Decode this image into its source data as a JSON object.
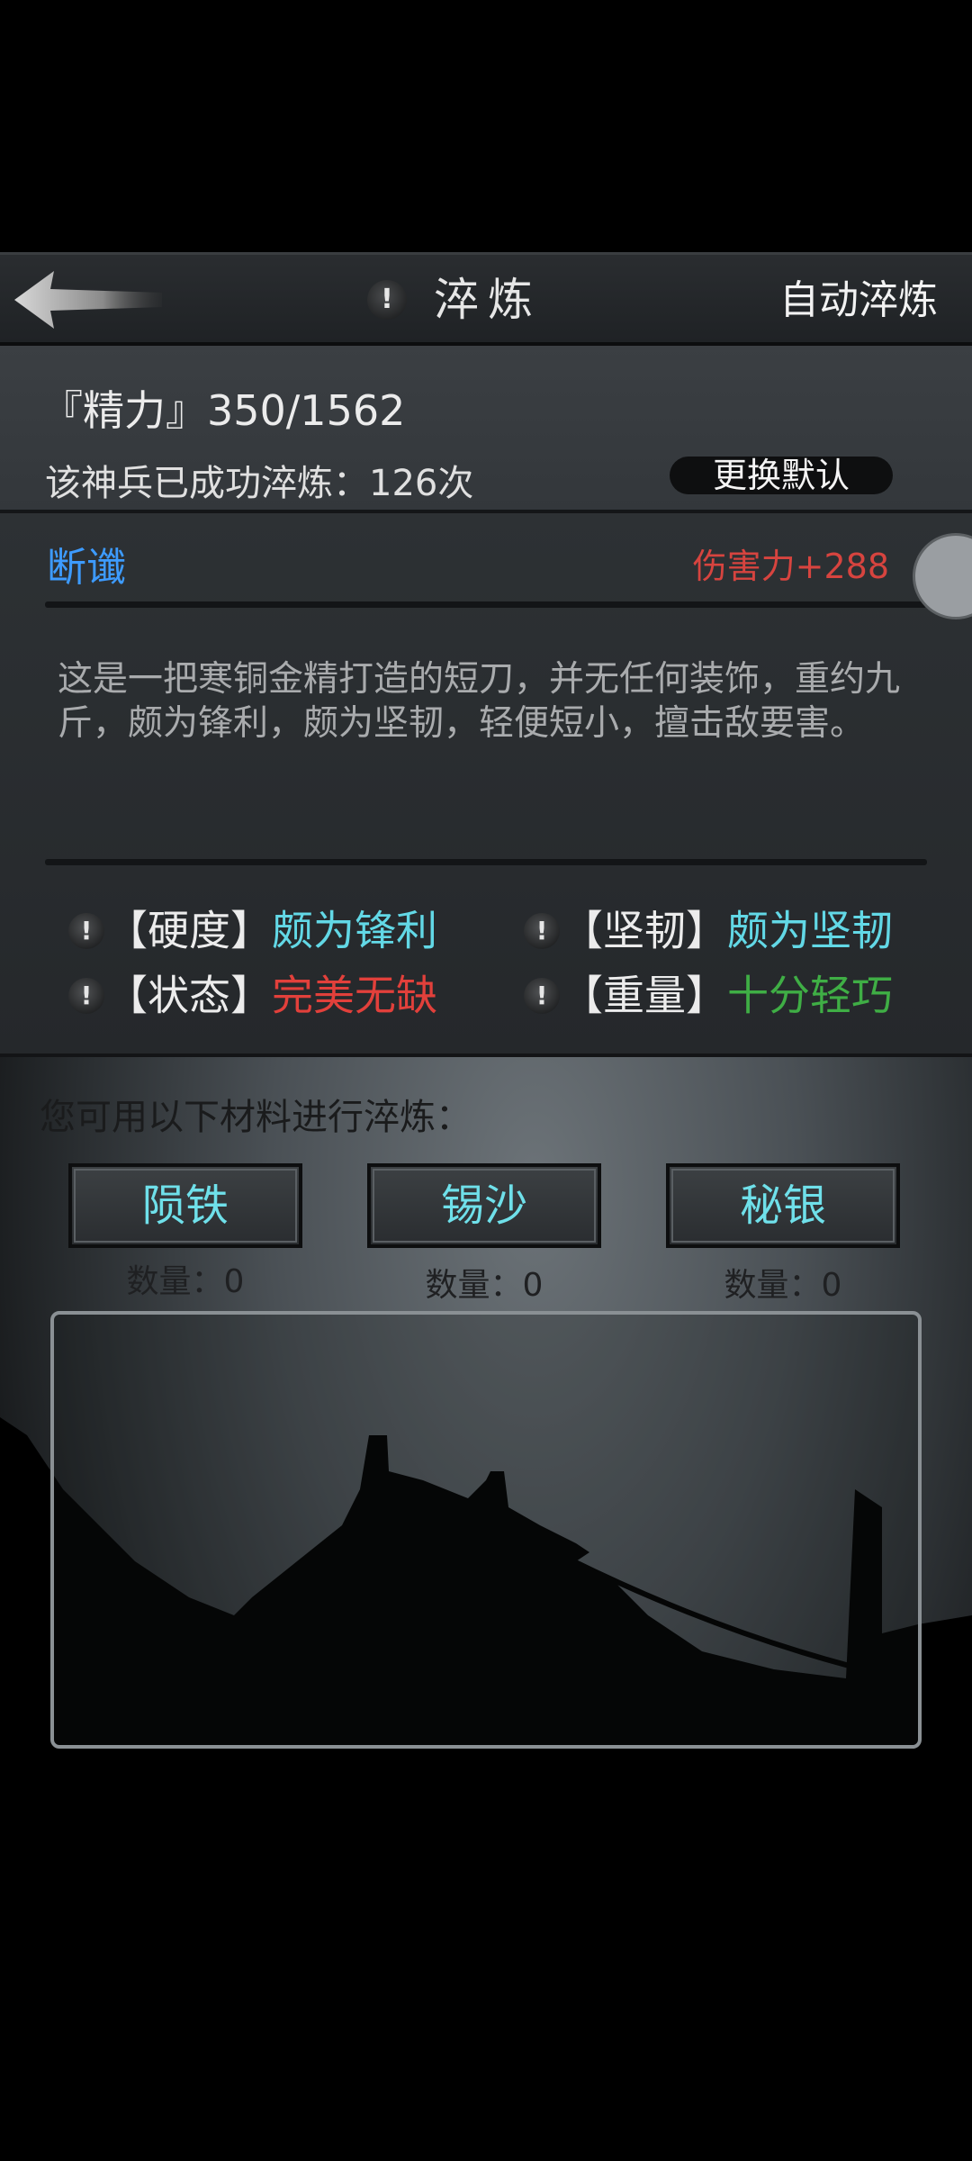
{
  "titlebar": {
    "title": "淬炼",
    "auto_refine": "自动淬炼",
    "info_icon": "!",
    "back_icon": "arrow-left-icon"
  },
  "info": {
    "energy": "『精力』350/1562",
    "refine_count": "该神兵已成功淬炼：126次",
    "swap_default": "更换默认"
  },
  "weapon": {
    "name": "断谶",
    "damage": "伤害力+288",
    "description": "这是一把寒铜金精打造的短刀，并无任何装饰，重约九斤，颇为锋利，颇为坚韧，轻便短小，擅击敌要害。",
    "attributes": [
      {
        "label": "【硬度】",
        "value": "颇为锋利",
        "color": "#62d8e6"
      },
      {
        "label": "【坚韧】",
        "value": "颇为坚韧",
        "color": "#62d8e6"
      },
      {
        "label": "【状态】",
        "value": "完美无缺",
        "color": "#e2403b"
      },
      {
        "label": "【重量】",
        "value": "十分轻巧",
        "color": "#3fae45"
      }
    ],
    "attr_icon": "!"
  },
  "materials": {
    "title": "您可用以下材料进行淬炼：",
    "items": [
      {
        "name": "陨铁",
        "count": "数量：0"
      },
      {
        "name": "锡沙",
        "count": "数量：0"
      },
      {
        "name": "秘银",
        "count": "数量：0"
      }
    ]
  },
  "colors": {
    "accent_blue": "#3d9bff",
    "damage_red": "#d7443f",
    "material_cyan": "#6fe0ea"
  }
}
